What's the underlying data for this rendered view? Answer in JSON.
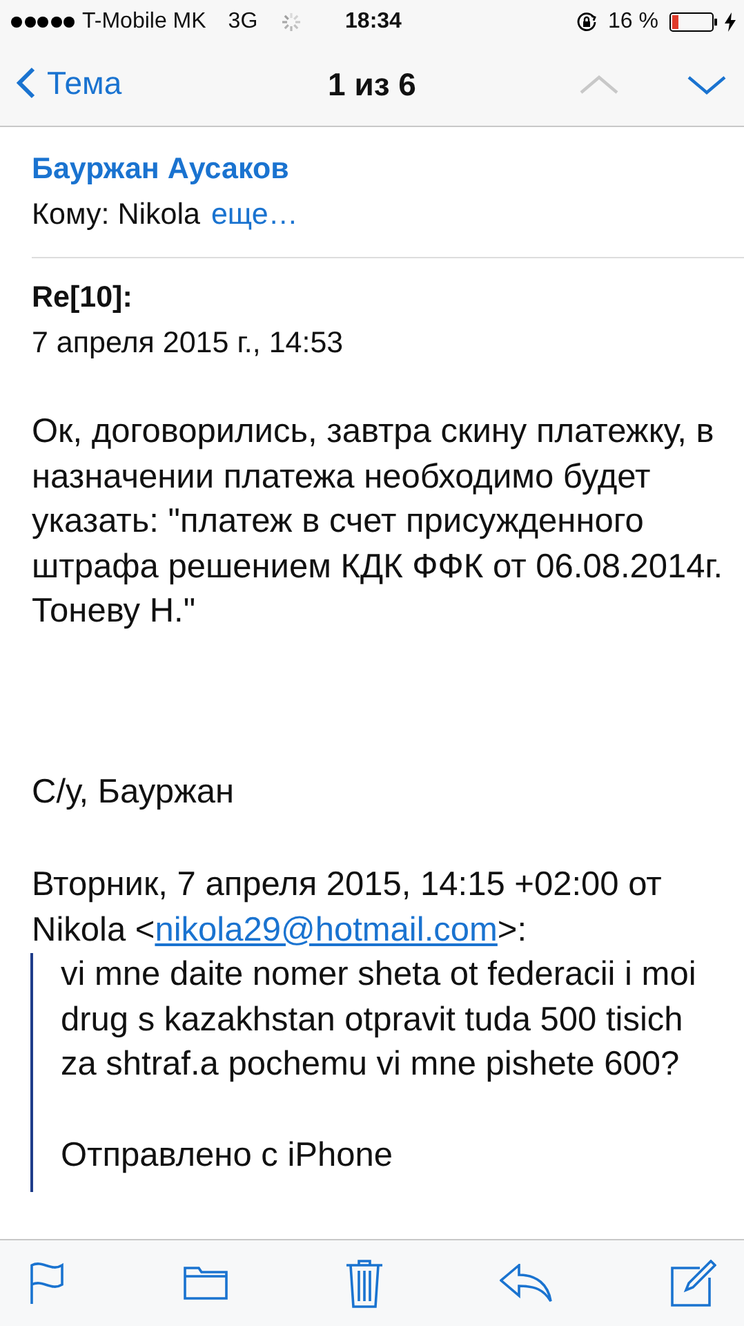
{
  "status_bar": {
    "carrier": "T-Mobile MK",
    "network": "3G",
    "time": "18:34",
    "battery_text": "16 %",
    "battery": {
      "level": 0.16
    },
    "charging": true
  },
  "nav": {
    "back": "Тема",
    "title": "1 из 6",
    "buttons": [
      {
        "kind": "up",
        "disabled": true
      },
      {
        "kind": "down",
        "disabled": false
      }
    ]
  },
  "header": {
    "sender": "Бауржан Аусаков",
    "to_label": "Кому: Nikola",
    "more": "еще…",
    "subject": "Re[10]:",
    "date": "7 апреля 2015 г., 14:53"
  },
  "body": [
    "Ок, договорились, завтра скину платежку, в назначении платежа необходимо будет указать: \"платеж в счет присужденного штрафа решением КДК ФФК от 06.08.2014г. Тоневу Н.\"",
    "С/у, Бауржан"
  ],
  "quote_header": {
    "text": "Вторник, 7 апреля 2015, 14:15 +02:00 от Nikola <",
    "link": "nikola29@hotmail.com",
    "after": ">:"
  },
  "quote": [
    "vi mne daite nomer sheta ot federacii i moi drug s kazakhstan otpravit tuda 500 tisich za shtraf.a pochemu vi mne pishete 600?",
    "Отправлено с iPhone"
  ],
  "toolbar": [
    {
      "kind": "flag"
    },
    {
      "kind": "folder"
    },
    {
      "kind": "trash"
    },
    {
      "kind": "reply"
    },
    {
      "kind": "compose"
    }
  ]
}
